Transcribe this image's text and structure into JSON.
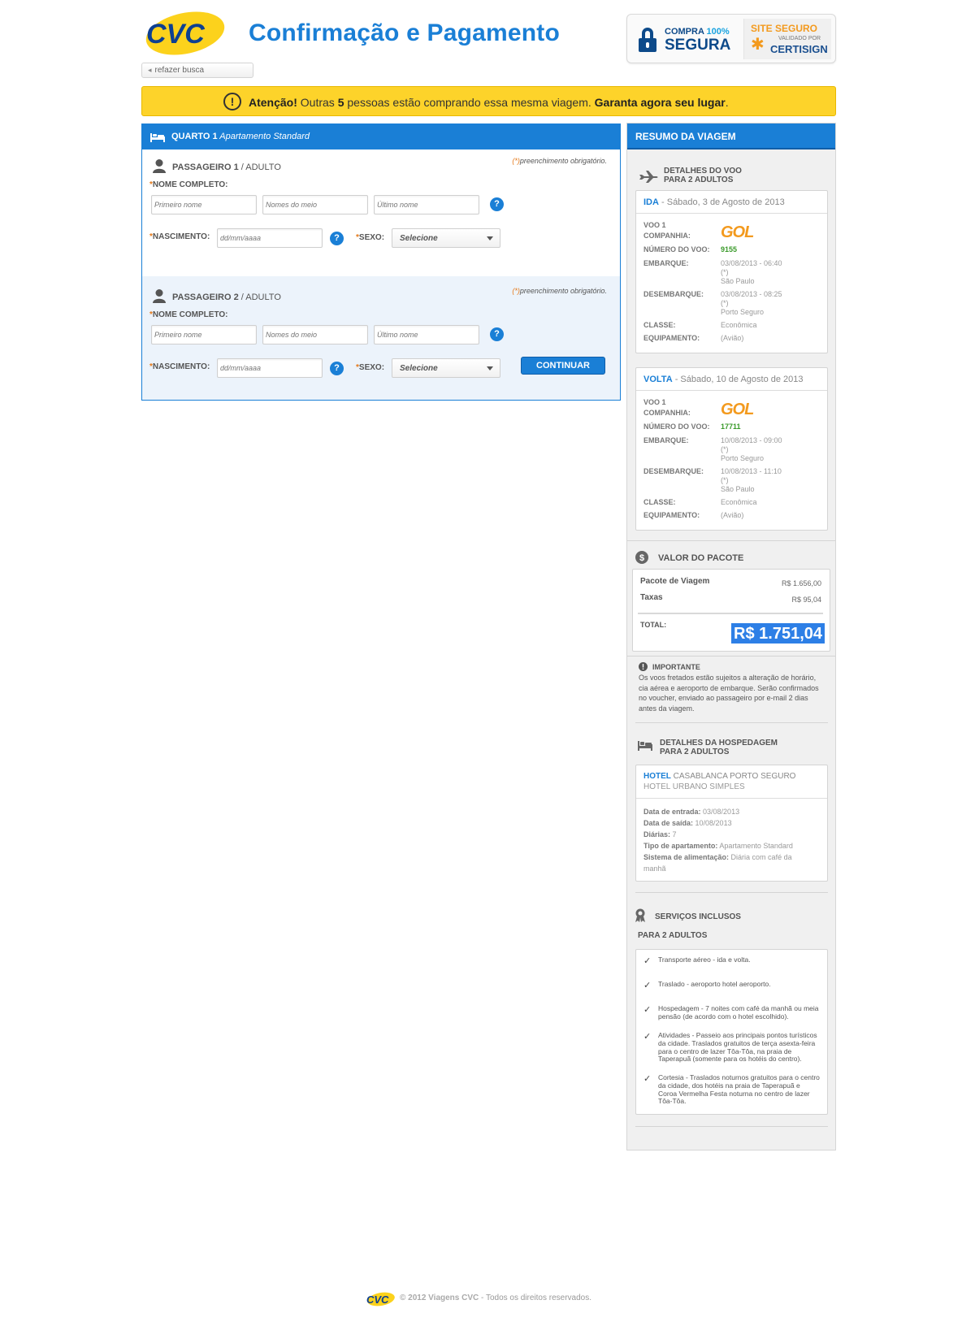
{
  "header": {
    "logo_text": "CVC",
    "title": "Confirmação e Pagamento",
    "back_link": "refazer busca",
    "badge_secure": {
      "top_prefix": "COMPRA ",
      "top_pct": "100%",
      "bottom": "SEGURA"
    },
    "badge_cert": {
      "top": "SITE SEGURO",
      "mid": "VALIDADO POR",
      "bottom": "CERTISIGN"
    }
  },
  "alert": {
    "icon": "exclamation-icon",
    "bold1": "Atenção!",
    "text1": " Outras ",
    "count": "5",
    "text2": " pessoas estão comprando essa mesma viagem. ",
    "bold2": "Garanta agora seu lugar",
    "end": "."
  },
  "room": {
    "title_bold": "QUARTO 1",
    "title_italic": " Apartamento Standard",
    "passengers": [
      {
        "label_bold": "PASSAGEIRO 1",
        "label_rest": " / ADULTO"
      },
      {
        "label_bold": "PASSAGEIRO 2",
        "label_rest": " / ADULTO"
      }
    ],
    "required_ast": "(*)",
    "required_note": "preenchimento obrigatório.",
    "ast": "*",
    "name_label": "NOME COMPLETO:",
    "placeholder_first": "Primeiro nome",
    "placeholder_middle": "Nomes do meio",
    "placeholder_last": "Último nome",
    "birth_label": "NASCIMENTO:",
    "birth_placeholder": "dd/mm/aaaa",
    "sex_label": "SEXO:",
    "sex_value": "Selecione",
    "help": "?",
    "continue_button": "CONTINUAR"
  },
  "summary": {
    "title": "RESUMO DA VIAGEM",
    "flight_title_1": "DETALHES DO VOO",
    "flight_title_2": "PARA 2 ADULTOS",
    "labels": {
      "flight": "VOO 1",
      "company": "COMPANHIA:",
      "flight_number": "NÚMERO DO VOO:",
      "departure": "EMBARQUE:",
      "arrival": "DESEMBARQUE:",
      "class": "CLASSE:",
      "equipment": "EQUIPAMENTO:"
    },
    "outbound": {
      "head_bold": "IDA",
      "head_rest": " - Sábado, 3 de Agosto de 2013",
      "airline": "GOL",
      "number": "9155",
      "dep_time": "03/08/2013 - 06:40",
      "dep_note": "(*)",
      "dep_city": "São Paulo",
      "arr_time": "03/08/2013 - 08:25",
      "arr_note": "(*)",
      "arr_city": "Porto Seguro",
      "class": "Econômica",
      "equipment": "(Avião)"
    },
    "inbound": {
      "head_bold": "VOLTA",
      "head_rest": " - Sábado, 10 de Agosto de 2013",
      "airline": "GOL",
      "number": "17711",
      "dep_time": "10/08/2013 - 09:00",
      "dep_note": "(*)",
      "dep_city": "Porto Seguro",
      "arr_time": "10/08/2013 - 11:10",
      "arr_note": "(*)",
      "arr_city": "São Paulo",
      "class": "Econômica",
      "equipment": "(Avião)"
    },
    "price": {
      "title": "VALOR DO PACOTE",
      "package_label": "Pacote de Viagem",
      "package_value": "R$ 1.656,00",
      "taxes_label": "Taxas",
      "taxes_value": "R$ 95,04",
      "total_label": "TOTAL:",
      "total_value": "R$ 1.751,04"
    },
    "important": {
      "title": "IMPORTANTE",
      "text": "Os voos fretados estão sujeitos a alteração de horário, cia aérea e aeroporto de embarque. Serão confirmados no voucher, enviado ao passageiro por e-mail 2 dias antes da viagem."
    },
    "hotel": {
      "title_1": "DETALHES DA HOSPEDAGEM",
      "title_2": "PARA 2 ADULTOS",
      "head_bold": "HOTEL",
      "head_name": " CASABLANCA PORTO SEGURO",
      "subtitle": "HOTEL URBANO SIMPLES",
      "checkin_label": "Data de entrada:",
      "checkin": " 03/08/2013",
      "checkout_label": "Data de saída:",
      "checkout": " 10/08/2013",
      "nights_label": "Diárias:",
      "nights": " 7",
      "room_label": "Tipo de apartamento:",
      "room": " Apartamento Standard",
      "meal_label": "Sistema de alimentação:",
      "meal_1": " Diária com café da",
      "meal_2": "manhã"
    },
    "services": {
      "title": "SERVIÇOS INCLUSOS",
      "subtitle": "PARA 2 ADULTOS",
      "check": "✓",
      "items": [
        "Transporte aéreo - ida e volta.",
        "Traslado - aeroporto hotel aeroporto.",
        "Hospedagem - 7 noites com café da manhã ou meia pensão (de acordo com o hotel escolhido).",
        "Atividades - Passeio aos principais pontos turísticos da cidade. Traslados gratuitos de terça asexta-feira para o centro de lazer Tôa-Tôa, na praia de Taperapuã (somente para os hotéis do centro).",
        "Cortesia - Traslados noturnos gratuitos para o centro da cidade, dos hotéis na praia de Taperapuã e Coroa Vermelha Festa noturna no centro de lazer Tôa-Tôa."
      ]
    }
  },
  "footer": {
    "logo_text": "CVC",
    "copyright": "© 2012 Viagens CVC",
    "rest": " - Todos os direitos reservados."
  },
  "colors": {
    "brand_blue": "#1a7fd6",
    "alert_yellow": "#fdd32a",
    "gol_orange": "#f39a1e",
    "flight_number_green": "#3a9a2a"
  }
}
